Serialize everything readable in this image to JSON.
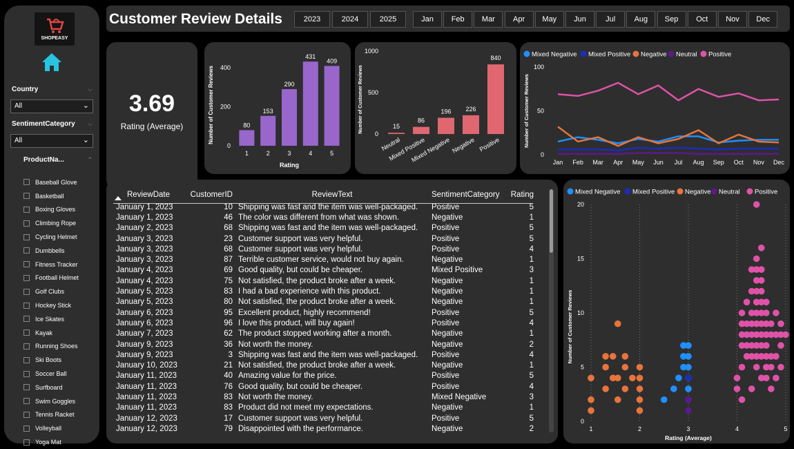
{
  "sidebar": {
    "brand": "SHOPEASY",
    "filters": [
      {
        "label": "Country",
        "value": "All"
      },
      {
        "label": "SentimentCategory",
        "value": "All"
      }
    ],
    "products_label": "ProductNa...",
    "products": [
      "Baseball Glove",
      "Basketball",
      "Boxing Gloves",
      "Climbing Rope",
      "Cycling Helmet",
      "Dumbbells",
      "Fitness Tracker",
      "Football Helmet",
      "Golf Clubs",
      "Hockey Stick",
      "Ice Skates",
      "Kayak",
      "Running Shoes",
      "Ski Boots",
      "Soccer Ball",
      "Surfboard",
      "Swim Goggles",
      "Tennis Racket",
      "Volleyball",
      "Yoga Mat"
    ]
  },
  "header": {
    "title": "Customer Review Details",
    "years": [
      "2023",
      "2024",
      "2025"
    ],
    "months": [
      "Jan",
      "Feb",
      "Mar",
      "Apr",
      "May",
      "Jun",
      "Jul",
      "Aug",
      "Sep",
      "Oct",
      "Nov",
      "Dec"
    ]
  },
  "kpi": {
    "value": "3.69",
    "label": "Rating (Average)"
  },
  "colors": {
    "purple": "#9966cc",
    "coral": "#e06770",
    "mixed_negative": "#1e90ff",
    "mixed_positive": "#1a2dbb",
    "negative": "#e8743b",
    "neutral": "#5a1a8a",
    "positive": "#e052a8"
  },
  "chart_data": [
    {
      "type": "bar",
      "categories": [
        "1",
        "2",
        "3",
        "4",
        "5"
      ],
      "values": [
        80,
        153,
        290,
        431,
        409
      ],
      "xlabel": "Rating",
      "ylabel": "Number of Customer Reviews",
      "yticks": [
        0,
        200,
        400
      ],
      "ylim": [
        0,
        460
      ]
    },
    {
      "type": "bar",
      "categories": [
        "Neutral",
        "Mixed Positive",
        "Mixed Negative",
        "Negative",
        "Positive"
      ],
      "values": [
        15,
        86,
        196,
        226,
        840
      ],
      "xlabel": "",
      "ylabel": "Number of Customer Reviews",
      "yticks": [
        0,
        500,
        1000
      ],
      "ylim": [
        0,
        1000
      ]
    },
    {
      "type": "line",
      "categories": [
        "Jan",
        "Feb",
        "Mar",
        "Apr",
        "May",
        "Jun",
        "Jul",
        "Aug",
        "Sep",
        "Oct",
        "Nov",
        "Dec"
      ],
      "ylabel": "Number of Customer Reviews",
      "yticks": [
        0,
        50,
        100
      ],
      "ylim": [
        0,
        100
      ],
      "legend": "top-left",
      "series": [
        {
          "name": "Mixed Negative",
          "values": [
            15,
            20,
            17,
            13,
            18,
            15,
            21,
            21,
            14,
            16,
            17,
            17
          ]
        },
        {
          "name": "Mixed Positive",
          "values": [
            6,
            6,
            6,
            5,
            8,
            7,
            8,
            7,
            6,
            7,
            7,
            7
          ]
        },
        {
          "name": "Negative",
          "values": [
            32,
            15,
            20,
            10,
            20,
            13,
            18,
            28,
            13,
            23,
            15,
            14
          ]
        },
        {
          "name": "Neutral",
          "values": [
            1,
            1,
            1,
            1,
            2,
            2,
            2,
            1,
            1,
            1,
            1,
            1
          ]
        },
        {
          "name": "Positive",
          "values": [
            69,
            67,
            73,
            82,
            69,
            79,
            62,
            75,
            66,
            70,
            62,
            63
          ]
        }
      ]
    },
    {
      "type": "scatter",
      "xlabel": "Rating (Average)",
      "ylabel": "Number of Customer Reviews",
      "xlim": [
        1,
        5
      ],
      "ylim": [
        0,
        20
      ],
      "xticks": [
        1,
        2,
        3,
        4,
        5
      ],
      "yticks": [
        0,
        5,
        10,
        15,
        20
      ],
      "legend": "top-left",
      "series": [
        {
          "name": "Mixed Negative",
          "points": [
            [
              2.5,
              2
            ],
            [
              2.7,
              3
            ],
            [
              2.8,
              4
            ],
            [
              2.9,
              5
            ],
            [
              2.9,
              6
            ],
            [
              2.9,
              7
            ],
            [
              3,
              3
            ],
            [
              3,
              4
            ],
            [
              3,
              5
            ],
            [
              3,
              6
            ],
            [
              3,
              7
            ]
          ]
        },
        {
          "name": "Mixed Positive",
          "points": [
            [
              3,
              4
            ],
            [
              3,
              2
            ]
          ]
        },
        {
          "name": "Negative",
          "points": [
            [
              1,
              1
            ],
            [
              1,
              2
            ],
            [
              1,
              4
            ],
            [
              1.3,
              3
            ],
            [
              1.3,
              5
            ],
            [
              1.3,
              6
            ],
            [
              1.45,
              4
            ],
            [
              1.45,
              6
            ],
            [
              1.55,
              2
            ],
            [
              1.55,
              4
            ],
            [
              1.55,
              9
            ],
            [
              1.7,
              3
            ],
            [
              1.7,
              5
            ],
            [
              1.7,
              6
            ],
            [
              1.85,
              4
            ],
            [
              2,
              1
            ],
            [
              2,
              2
            ],
            [
              2,
              3
            ],
            [
              2,
              4
            ],
            [
              2,
              5
            ]
          ]
        },
        {
          "name": "Neutral",
          "points": [
            [
              3,
              1
            ],
            [
              3,
              2
            ]
          ]
        },
        {
          "name": "Positive",
          "points": [
            [
              4,
              3
            ],
            [
              4,
              4
            ],
            [
              4.1,
              2
            ],
            [
              4.1,
              5
            ],
            [
              4.1,
              7
            ],
            [
              4.1,
              8
            ],
            [
              4.1,
              9
            ],
            [
              4.1,
              10
            ],
            [
              4.2,
              6
            ],
            [
              4.2,
              7
            ],
            [
              4.2,
              8
            ],
            [
              4.2,
              9
            ],
            [
              4.2,
              11
            ],
            [
              4.3,
              3
            ],
            [
              4.3,
              6
            ],
            [
              4.3,
              7
            ],
            [
              4.3,
              8
            ],
            [
              4.3,
              9
            ],
            [
              4.3,
              10
            ],
            [
              4.3,
              12
            ],
            [
              4.3,
              14
            ],
            [
              4.4,
              5
            ],
            [
              4.4,
              6
            ],
            [
              4.4,
              7
            ],
            [
              4.4,
              8
            ],
            [
              4.4,
              9
            ],
            [
              4.4,
              10
            ],
            [
              4.4,
              11
            ],
            [
              4.4,
              12
            ],
            [
              4.4,
              13
            ],
            [
              4.4,
              14
            ],
            [
              4.4,
              15
            ],
            [
              4.4,
              20
            ],
            [
              4.5,
              4
            ],
            [
              4.5,
              6
            ],
            [
              4.5,
              7
            ],
            [
              4.5,
              8
            ],
            [
              4.5,
              9
            ],
            [
              4.5,
              10
            ],
            [
              4.5,
              11
            ],
            [
              4.5,
              12
            ],
            [
              4.5,
              13
            ],
            [
              4.5,
              14
            ],
            [
              4.5,
              16
            ],
            [
              4.6,
              4
            ],
            [
              4.6,
              5
            ],
            [
              4.6,
              6
            ],
            [
              4.6,
              7
            ],
            [
              4.6,
              8
            ],
            [
              4.6,
              9
            ],
            [
              4.6,
              10
            ],
            [
              4.6,
              11
            ],
            [
              4.7,
              3
            ],
            [
              4.7,
              5
            ],
            [
              4.7,
              6
            ],
            [
              4.7,
              8
            ],
            [
              4.7,
              9
            ],
            [
              4.8,
              4
            ],
            [
              4.8,
              6
            ],
            [
              4.8,
              8
            ],
            [
              4.8,
              10
            ],
            [
              4.9,
              5
            ],
            [
              4.9,
              7
            ],
            [
              4.9,
              8
            ],
            [
              4.9,
              9
            ],
            [
              5,
              8
            ]
          ]
        }
      ]
    }
  ],
  "table": {
    "columns": [
      "ReviewDate",
      "CustomerID",
      "ReviewText",
      "SentimentCategory",
      "Rating"
    ],
    "rows": [
      [
        "January 1, 2023",
        "10",
        "Shipping was fast and the item was well-packaged.",
        "Positive",
        "5"
      ],
      [
        "January 1, 2023",
        "46",
        "The color was different from what was shown.",
        "Negative",
        "1"
      ],
      [
        "January 2, 2023",
        "68",
        "Shipping was fast and the item was well-packaged.",
        "Positive",
        "5"
      ],
      [
        "January 3, 2023",
        "23",
        "Customer support was very helpful.",
        "Positive",
        "5"
      ],
      [
        "January 3, 2023",
        "68",
        "Customer support was very helpful.",
        "Positive",
        "4"
      ],
      [
        "January 3, 2023",
        "87",
        "Terrible customer service, would not buy again.",
        "Negative",
        "1"
      ],
      [
        "January 4, 2023",
        "69",
        "Good quality, but could be cheaper.",
        "Mixed Positive",
        "3"
      ],
      [
        "January 4, 2023",
        "75",
        "Not satisfied, the product broke after a week.",
        "Negative",
        "1"
      ],
      [
        "January 5, 2023",
        "83",
        "I had a bad experience with this product.",
        "Negative",
        "1"
      ],
      [
        "January 5, 2023",
        "80",
        "Not satisfied, the product broke after a week.",
        "Negative",
        "1"
      ],
      [
        "January 6, 2023",
        "95",
        "Excellent product, highly recommend!",
        "Positive",
        "5"
      ],
      [
        "January 6, 2023",
        "96",
        "I love this product, will buy again!",
        "Positive",
        "4"
      ],
      [
        "January 7, 2023",
        "62",
        "The product stopped working after a month.",
        "Negative",
        "1"
      ],
      [
        "January 9, 2023",
        "36",
        "Not worth the money.",
        "Negative",
        "2"
      ],
      [
        "January 9, 2023",
        "3",
        "Shipping was fast and the item was well-packaged.",
        "Positive",
        "4"
      ],
      [
        "January 10, 2023",
        "21",
        "Not satisfied, the product broke after a week.",
        "Negative",
        "1"
      ],
      [
        "January 11, 2023",
        "40",
        "Amazing value for the price.",
        "Positive",
        "5"
      ],
      [
        "January 11, 2023",
        "76",
        "Good quality, but could be cheaper.",
        "Positive",
        "4"
      ],
      [
        "January 11, 2023",
        "83",
        "Not worth the money.",
        "Mixed Negative",
        "3"
      ],
      [
        "January 11, 2023",
        "83",
        "Product did not meet my expectations.",
        "Negative",
        "1"
      ],
      [
        "January 12, 2023",
        "17",
        "Customer support was very helpful.",
        "Positive",
        "5"
      ],
      [
        "January 12, 2023",
        "79",
        "Disappointed with the performance.",
        "Negative",
        "2"
      ]
    ]
  }
}
